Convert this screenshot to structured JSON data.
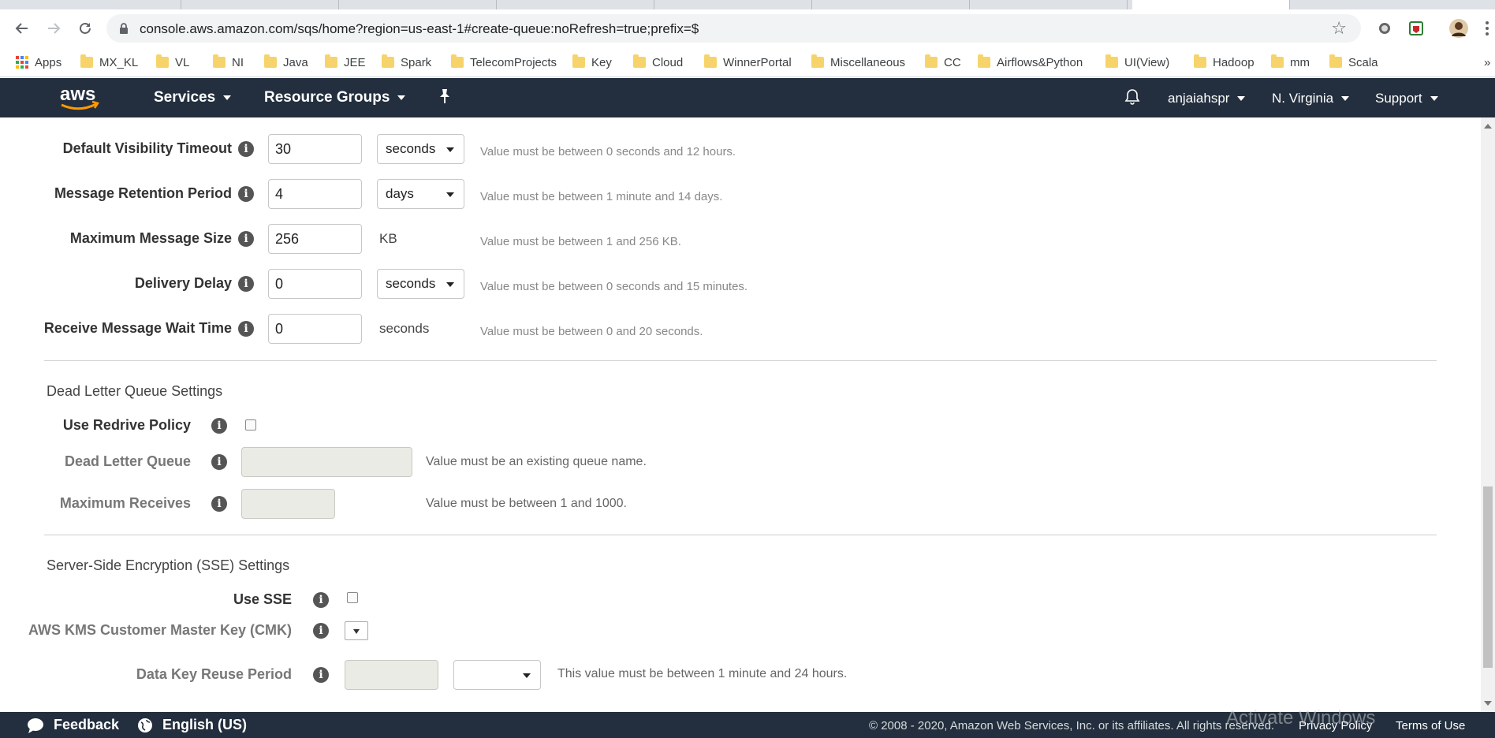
{
  "browser": {
    "url": "console.aws.amazon.com/sqs/home?region=us-east-1#create-queue:noRefresh=true;prefix=$",
    "bookmarks": [
      "Apps",
      "MX_KL",
      "VL",
      "NI",
      "Java",
      "JEE",
      "Spark",
      "TelecomProjects",
      "Key",
      "Cloud",
      "WinnerPortal",
      "Miscellaneous",
      "CC",
      "Airflows&Python",
      "UI(View)",
      "Hadoop",
      "mm",
      "Scala"
    ],
    "overflow": "»"
  },
  "awsnav": {
    "services": "Services",
    "resource_groups": "Resource Groups",
    "user": "anjaiahspr",
    "region": "N. Virginia",
    "support": "Support"
  },
  "queue_settings": {
    "visibility": {
      "label": "Default Visibility Timeout",
      "value": "30",
      "unit": "seconds",
      "hint": "Value must be between 0 seconds and 12 hours."
    },
    "retention": {
      "label": "Message Retention Period",
      "value": "4",
      "unit": "days",
      "hint": "Value must be between 1 minute and 14 days."
    },
    "max_size": {
      "label": "Maximum Message Size",
      "value": "256",
      "unit": "KB",
      "hint": "Value must be between 1 and 256 KB."
    },
    "delivery_delay": {
      "label": "Delivery Delay",
      "value": "0",
      "unit": "seconds",
      "hint": "Value must be between 0 seconds and 15 minutes."
    },
    "wait_time": {
      "label": "Receive Message Wait Time",
      "value": "0",
      "unit": "seconds",
      "hint": "Value must be between 0 and 20 seconds."
    }
  },
  "dlq": {
    "title": "Dead Letter Queue Settings",
    "redrive_label": "Use Redrive Policy",
    "queue_label": "Dead Letter Queue",
    "queue_hint": "Value must be an existing queue name.",
    "max_receives_label": "Maximum Receives",
    "max_receives_hint": "Value must be between 1 and 1000."
  },
  "sse": {
    "title": "Server-Side Encryption (SSE) Settings",
    "use_label": "Use SSE",
    "cmk_label": "AWS KMS Customer Master Key (CMK)",
    "reuse_label": "Data Key Reuse Period",
    "reuse_hint": "This value must be between 1 minute and 24 hours."
  },
  "footer": {
    "feedback": "Feedback",
    "language": "English (US)",
    "copyright": "© 2008 - 2020, Amazon Web Services, Inc. or its affiliates. All rights reserved.",
    "privacy": "Privacy Policy",
    "terms": "Terms of Use"
  },
  "watermark": "Activate Windows",
  "colors": {
    "aws_nav": "#232f3e",
    "aws_orange": "#ff9900",
    "folder": "#f6d46b"
  }
}
